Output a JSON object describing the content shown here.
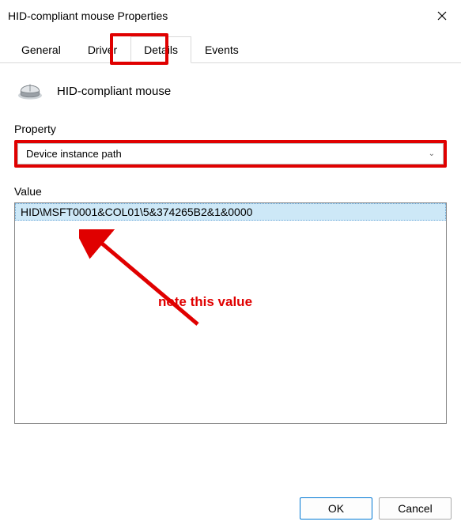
{
  "window": {
    "title": "HID-compliant mouse Properties"
  },
  "tabs": {
    "general": "General",
    "driver": "Driver",
    "details": "Details",
    "events": "Events"
  },
  "device": {
    "name": "HID-compliant mouse"
  },
  "labels": {
    "property": "Property",
    "value": "Value"
  },
  "property": {
    "selected": "Device instance path"
  },
  "values": [
    "HID\\MSFT0001&COL01\\5&374265B2&1&0000"
  ],
  "annotation": {
    "note": "note this value"
  },
  "buttons": {
    "ok": "OK",
    "cancel": "Cancel"
  },
  "colors": {
    "highlight": "#e00000",
    "selection_bg": "#cde8f7"
  }
}
